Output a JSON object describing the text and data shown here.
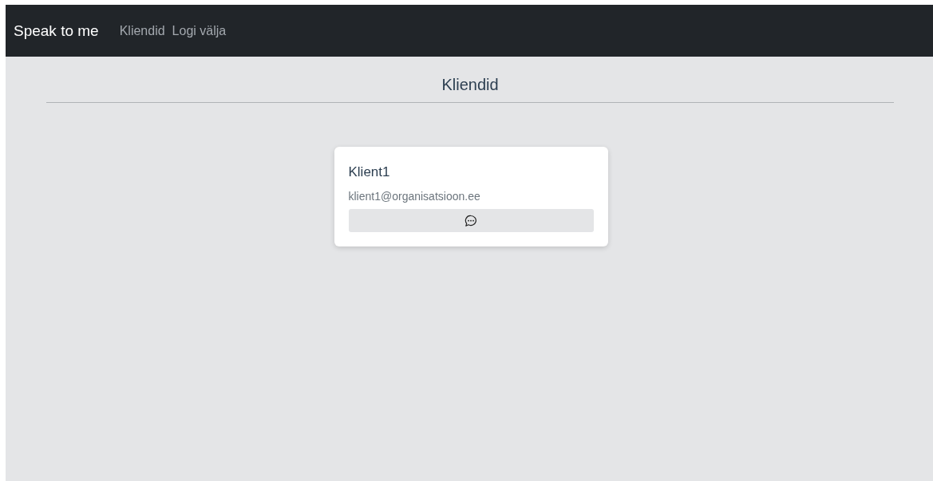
{
  "navbar": {
    "brand": "Speak to me",
    "links": [
      {
        "label": "Kliendid"
      },
      {
        "label": "Logi välja"
      }
    ]
  },
  "page": {
    "title": "Kliendid"
  },
  "clients": [
    {
      "name": "Klient1",
      "email": "klient1@organisatsioon.ee"
    }
  ]
}
